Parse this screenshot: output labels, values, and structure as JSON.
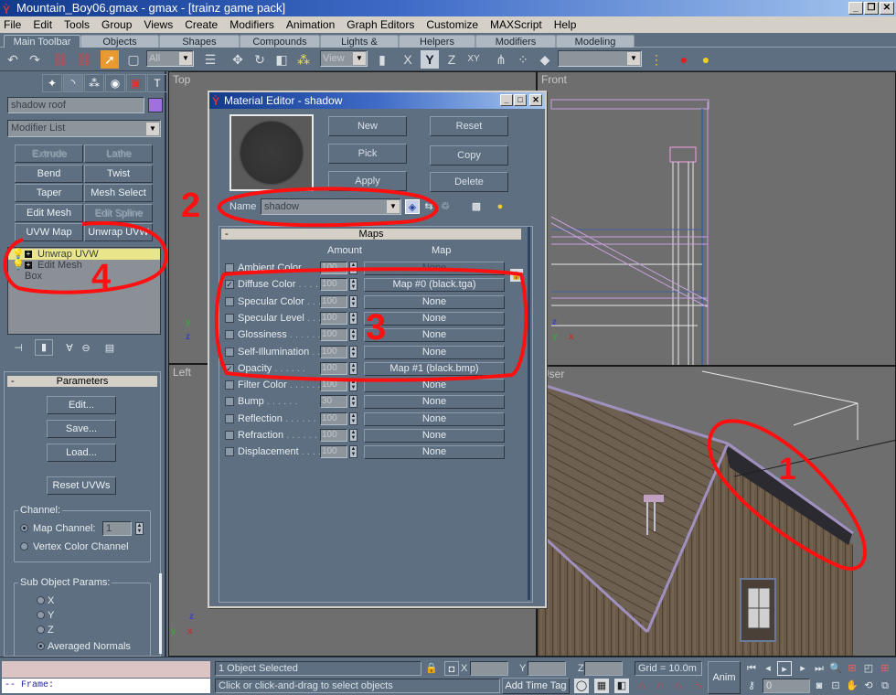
{
  "window": {
    "title": "Mountain_Boy06.gmax - gmax - [trainz game pack]",
    "controls": {
      "minimize": "_",
      "restore": "❐",
      "close": "✕"
    }
  },
  "menu": [
    "File",
    "Edit",
    "Tools",
    "Group",
    "Views",
    "Create",
    "Modifiers",
    "Animation",
    "Graph Editors",
    "Customize",
    "MAXScript",
    "Help"
  ],
  "tabs": [
    "Main Toolbar",
    "Objects",
    "Shapes",
    "Compounds",
    "Lights & Cameras",
    "Helpers",
    "Modifiers",
    "Modeling"
  ],
  "toolbar": {
    "selection_filter": "All",
    "reference_coord": "View",
    "named_selection": "",
    "axis_constraints": [
      "X",
      "Y",
      "Z",
      "XY"
    ]
  },
  "command_panel": {
    "tab_icons": [
      "create-icon",
      "modify-icon",
      "hierarchy-icon",
      "motion-icon",
      "display-icon",
      "utilities-icon"
    ],
    "object_name": "shadow roof",
    "object_color": "#a070e0",
    "modifier_list": "Modifier List",
    "modifier_buttons": [
      {
        "label": "Extrude",
        "enabled": false
      },
      {
        "label": "Lathe",
        "enabled": false
      },
      {
        "label": "Bend",
        "enabled": true
      },
      {
        "label": "Twist",
        "enabled": true
      },
      {
        "label": "Taper",
        "enabled": true
      },
      {
        "label": "Mesh Select",
        "enabled": true
      },
      {
        "label": "Edit Mesh",
        "enabled": true
      },
      {
        "label": "Edit Spline",
        "enabled": false
      },
      {
        "label": "UVW Map",
        "enabled": true
      },
      {
        "label": "Unwrap UVW",
        "enabled": true
      }
    ],
    "stack": [
      {
        "label": "Unwrap UVW",
        "selected": true
      },
      {
        "label": "Edit Mesh",
        "selected": false
      },
      {
        "label": "Box",
        "selected": false
      }
    ],
    "parameters": {
      "title": "Parameters",
      "buttons": [
        "Edit...",
        "Save...",
        "Load...",
        "Reset UVWs"
      ],
      "channel": {
        "title": "Channel:",
        "map_channel_label": "Map Channel:",
        "map_channel_value": "1",
        "vertex_color_label": "Vertex Color Channel",
        "selected": "map"
      },
      "sub_object": {
        "title": "Sub Object Params:",
        "options": [
          "X",
          "Y",
          "Z",
          "Averaged Normals"
        ],
        "selected": "Averaged Normals"
      }
    }
  },
  "viewports": {
    "top": "Top",
    "front": "Front",
    "left": "Left",
    "user": "User"
  },
  "material_editor": {
    "title": "Material Editor - shadow",
    "buttons": [
      "New",
      "Reset",
      "Pick",
      "Copy",
      "Apply",
      "Delete"
    ],
    "name_label": "Name",
    "name_value": "shadow",
    "maps_title": "Maps",
    "col_amount": "Amount",
    "col_map": "Map",
    "maps": [
      {
        "label": "Ambient Color",
        "amount": "100",
        "map": "None",
        "checked": false
      },
      {
        "label": "Diffuse Color",
        "amount": "100",
        "map": "Map #0 (black.tga)",
        "checked": true
      },
      {
        "label": "Specular Color",
        "amount": "100",
        "map": "None",
        "checked": false
      },
      {
        "label": "Specular Level",
        "amount": "100",
        "map": "None",
        "checked": false
      },
      {
        "label": "Glossiness",
        "amount": "100",
        "map": "None",
        "checked": false
      },
      {
        "label": "Self-Illumination",
        "amount": "100",
        "map": "None",
        "checked": false
      },
      {
        "label": "Opacity",
        "amount": "100",
        "map": "Map #1 (black.bmp)",
        "checked": true
      },
      {
        "label": "Filter Color",
        "amount": "100",
        "map": "None",
        "checked": false
      },
      {
        "label": "Bump",
        "amount": "30",
        "map": "None",
        "checked": false
      },
      {
        "label": "Reflection",
        "amount": "100",
        "map": "None",
        "checked": false
      },
      {
        "label": "Refraction",
        "amount": "100",
        "map": "None",
        "checked": false
      },
      {
        "label": "Displacement",
        "amount": "100",
        "map": "None",
        "checked": false
      }
    ]
  },
  "annotations": [
    "1",
    "2",
    "3",
    "4"
  ],
  "status": {
    "listener_prompt": "-- Frame:",
    "selection": "1 Object Selected",
    "prompt": "Click or click-and-drag to select objects",
    "x_label": "X",
    "y_label": "Y",
    "z_label": "Z",
    "x_value": "",
    "y_value": "",
    "z_value": "",
    "grid": "Grid = 10.0m",
    "add_time_tag": "Add Time Tag",
    "anim": "Anim",
    "frame": "0"
  }
}
